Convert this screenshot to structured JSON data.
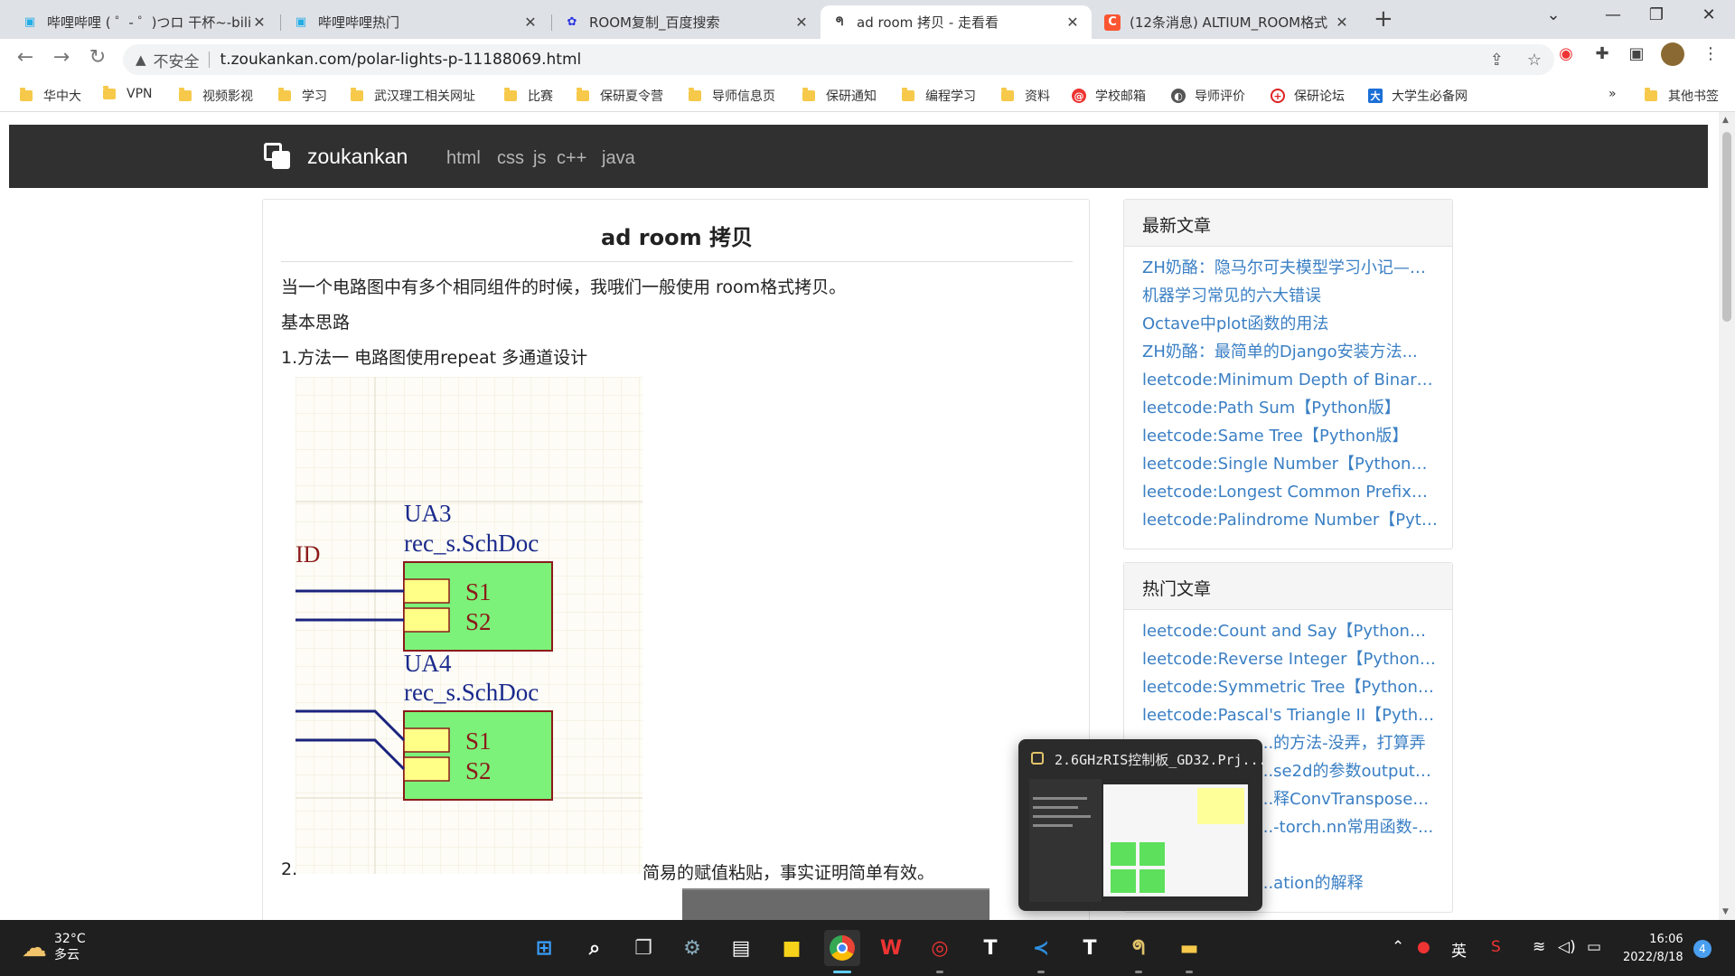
{
  "browser": {
    "tabs": [
      {
        "title": "哔哩哔哩 ( ゜- ゜)つロ 干杯~-bili",
        "favicon": "bilibili-icon",
        "active": false
      },
      {
        "title": "哔哩哔哩热门",
        "favicon": "bilibili-icon",
        "active": false
      },
      {
        "title": "ROOM复制_百度搜索",
        "favicon": "baidu-icon",
        "active": false
      },
      {
        "title": "ad room 拷贝 - 走看看",
        "favicon": "zoukankan-icon",
        "active": true
      },
      {
        "title": "(12条消息) ALTIUM_ROOM格式",
        "favicon": "csdn-icon",
        "active": false
      }
    ],
    "address": {
      "security_label": "不安全",
      "url": "t.zoukankan.com/polar-lights-p-11188069.html"
    },
    "bookmarks": [
      {
        "label": "华中大",
        "icon": "folder-icon"
      },
      {
        "label": "VPN",
        "icon": "folder-icon"
      },
      {
        "label": "视频影视",
        "icon": "folder-icon"
      },
      {
        "label": "学习",
        "icon": "folder-icon"
      },
      {
        "label": "武汉理工相关网址",
        "icon": "folder-icon"
      },
      {
        "label": "比赛",
        "icon": "folder-icon"
      },
      {
        "label": "保研夏令营",
        "icon": "folder-icon"
      },
      {
        "label": "导师信息页",
        "icon": "folder-icon"
      },
      {
        "label": "保研通知",
        "icon": "folder-icon"
      },
      {
        "label": "编程学习",
        "icon": "folder-icon"
      },
      {
        "label": "资料",
        "icon": "folder-icon"
      },
      {
        "label": "学校邮箱",
        "icon": "mail-icon"
      },
      {
        "label": "导师评价",
        "icon": "globe-icon"
      },
      {
        "label": "保研论坛",
        "icon": "forum-icon"
      },
      {
        "label": "大学生必备网",
        "icon": "site-icon"
      }
    ],
    "more_bookmarks_chevron": "»",
    "other_bookmarks": "其他书签"
  },
  "site": {
    "brand": "zoukankan",
    "nav": [
      "html",
      "css",
      "js",
      "c++",
      "java"
    ]
  },
  "article": {
    "title": "ad room 拷贝",
    "p1": "当一个电路图中有多个相同组件的时候，我哦们一般使用 room格式拷贝。",
    "p2": "基本思路",
    "p3": "1.方法一  电路图使用repeat 多通道设计",
    "p4_num": "2.",
    "p4_text": "简易的赋值粘贴，事实证明简单有效。",
    "schematic": {
      "partial_label": "ID",
      "blocks": [
        {
          "designator": "UA3",
          "file": "rec_s.SchDoc",
          "ports": [
            "S1",
            "S2"
          ]
        },
        {
          "designator": "UA4",
          "file": "rec_s.SchDoc",
          "ports": [
            "S1",
            "S2"
          ]
        }
      ]
    }
  },
  "sidebar": {
    "latest": {
      "heading": "最新文章",
      "items": [
        "ZH奶酪：隐马尔可夫模型学习小记——...",
        "机器学习常见的六大错误",
        "Octave中plot函数的用法",
        "ZH奶酪：最简单的Django安装方法...",
        "leetcode:Minimum Depth of Binary T...",
        "leetcode:Path Sum【Python版】",
        "leetcode:Same Tree【Python版】",
        "leetcode:Single Number【Python版】",
        "leetcode:Longest Common Prefix【P...",
        "leetcode:Palindrome Number【Pyth..."
      ]
    },
    "hot": {
      "heading": "热门文章",
      "items": [
        "leetcode:Count and Say【Python版】",
        "leetcode:Reverse Integer【Python版】",
        "leetcode:Symmetric Tree【Python版】",
        "leetcode:Pascal's Triangle II【Python...",
        "...的方法-没弄，打算弄",
        "...se2d的参数output_p...",
        "...释ConvTranspose2d...",
        "...-torch.nn常用函数-...",
        "",
        "...ation的解释"
      ]
    }
  },
  "taskbar": {
    "weather_temp": "32°C",
    "weather_desc": "多云",
    "preview_title": "2.6GHzRIS控制板_GD32.Prj...",
    "ime": "英",
    "time": "16:06",
    "date": "2022/8/18",
    "notification_count": "4"
  }
}
